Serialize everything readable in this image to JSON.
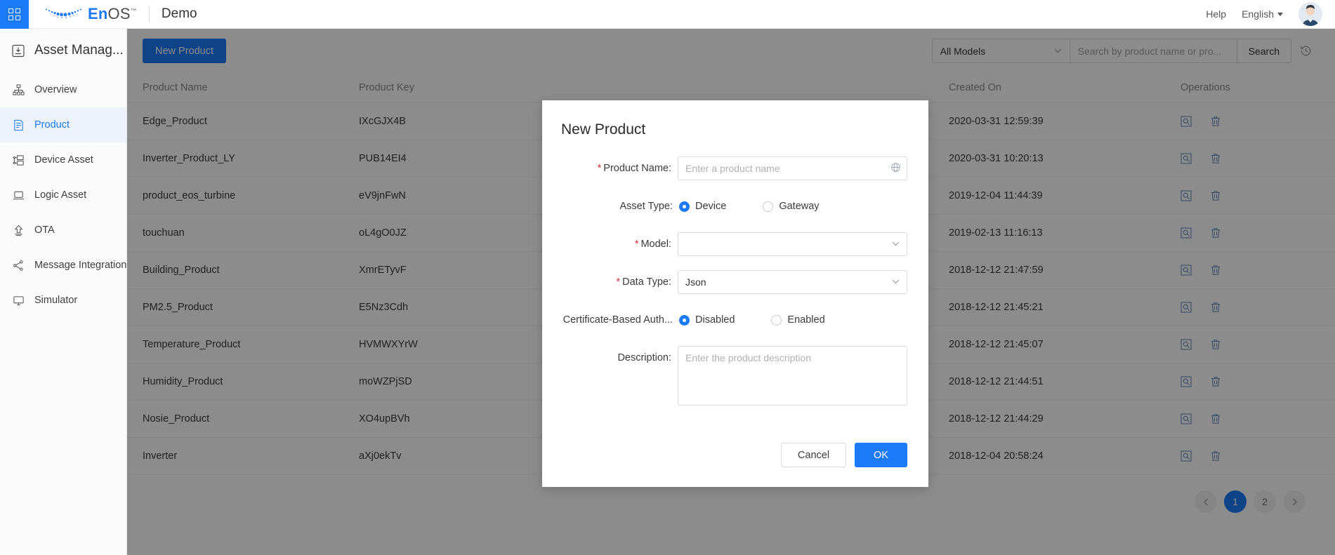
{
  "header": {
    "apps_icon": "grid-apps-icon",
    "brand": "EnOS",
    "brand_tm": "™",
    "brand_os_part": "OS",
    "brand_en_part": "En",
    "workspace": "Demo",
    "help": "Help",
    "language": "English",
    "avatar": "user-avatar"
  },
  "sidebar": {
    "title": "Asset Manag...",
    "items": [
      {
        "label": "Overview",
        "icon": "hierarchy-icon",
        "active": false
      },
      {
        "label": "Product",
        "icon": "document-icon",
        "active": true
      },
      {
        "label": "Device Asset",
        "icon": "device-node-icon",
        "active": false
      },
      {
        "label": "Logic Asset",
        "icon": "laptop-icon",
        "active": false
      },
      {
        "label": "OTA",
        "icon": "upload-arrow-icon",
        "active": false
      },
      {
        "label": "Message Integration",
        "icon": "share-nodes-icon",
        "active": false
      },
      {
        "label": "Simulator",
        "icon": "monitor-icon",
        "active": false
      }
    ]
  },
  "toolbar": {
    "new_product_label": "New Product",
    "model_filter_value": "All Models",
    "search_placeholder": "Search by product name or pro...",
    "search_value": "",
    "search_button_label": "Search",
    "history_icon": "history-clock-icon"
  },
  "table": {
    "columns": [
      "Product Name",
      "Product Key",
      "",
      "Created On",
      "Operations"
    ],
    "rows": [
      {
        "name": "Edge_Product",
        "key": "IXcGJX4B",
        "created": "2020-03-31 12:59:39"
      },
      {
        "name": "Inverter_Product_LY",
        "key": "PUB14EI4",
        "created": "2020-03-31 10:20:13"
      },
      {
        "name": "product_eos_turbine",
        "key": "eV9jnFwN",
        "created": "2019-12-04 11:44:39"
      },
      {
        "name": "touchuan",
        "key": "oL4gO0JZ",
        "created": "2019-02-13 11:16:13"
      },
      {
        "name": "Building_Product",
        "key": "XmrETyvF",
        "created": "2018-12-12 21:47:59"
      },
      {
        "name": "PM2.5_Product",
        "key": "E5Nz3Cdh",
        "created": "2018-12-12 21:45:21"
      },
      {
        "name": "Temperature_Product",
        "key": "HVMWXYrW",
        "created": "2018-12-12 21:45:07"
      },
      {
        "name": "Humidity_Product",
        "key": "moWZPjSD",
        "created": "2018-12-12 21:44:51"
      },
      {
        "name": "Nosie_Product",
        "key": "XO4upBVh",
        "created": "2018-12-12 21:44:29"
      },
      {
        "name": "Inverter",
        "key": "aXj0ekTv",
        "created": "2018-12-04 20:58:24"
      }
    ],
    "row_ops": {
      "view_icon": "view-details-icon",
      "delete_icon": "trash-icon"
    }
  },
  "pagination": {
    "prev_icon": "chevron-left-icon",
    "next_icon": "chevron-right-icon",
    "pages": [
      "1",
      "2"
    ],
    "current": "1"
  },
  "modal": {
    "title": "New Product",
    "fields": {
      "product_name_label": "Product Name",
      "product_name_placeholder": "Enter a product name",
      "product_name_value": "",
      "product_name_suffix_icon": "globe-translate-icon",
      "asset_type_label": "Asset Type",
      "asset_type_options": [
        "Device",
        "Gateway"
      ],
      "asset_type_selected": "Device",
      "model_label": "Model",
      "model_value": "",
      "data_type_label": "Data Type",
      "data_type_value": "Json",
      "cert_auth_label": "Certificate-Based Auth...",
      "cert_auth_options": [
        "Disabled",
        "Enabled"
      ],
      "cert_auth_selected": "Disabled",
      "description_label": "Description",
      "description_placeholder": "Enter the product description",
      "description_value": ""
    },
    "cancel_label": "Cancel",
    "ok_label": "OK"
  },
  "colors": {
    "accent": "#1a7af8",
    "required": "#e03131",
    "sidebar_active_bg": "#eef3fb",
    "overlay": "rgba(0,0,0,0.45)"
  }
}
